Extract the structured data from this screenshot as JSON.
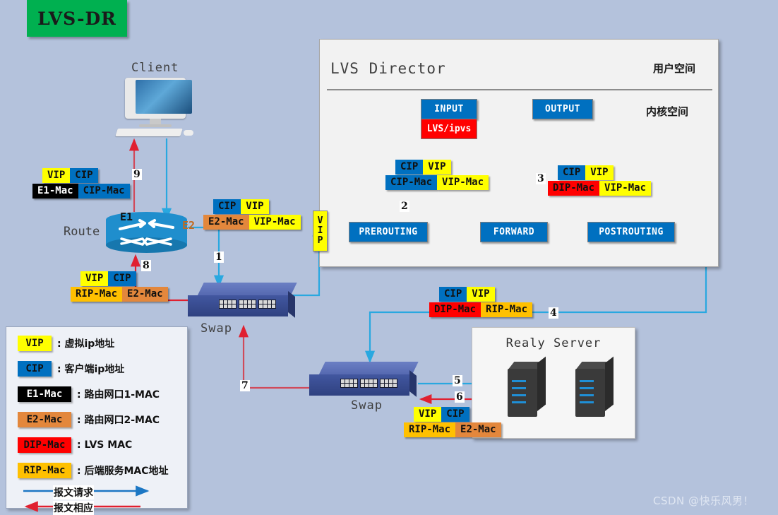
{
  "title": {
    "badge": "LVS-DR"
  },
  "nodes": {
    "client_label": "Client",
    "router_label": "Route",
    "router_if1": "E1",
    "router_if2": "E2",
    "switch1_label": "Swap",
    "switch2_label": "Swap",
    "realy_server_title": "Realy Server"
  },
  "director": {
    "title": "LVS Director",
    "user_space": "用户空间",
    "kernel_space": "内核空间",
    "input": "INPUT",
    "ipvs": "LVS/ipvs",
    "output": "OUTPUT",
    "prerouting": "PREROUTING",
    "forward": "FORWARD",
    "postrouting": "POSTROUTING",
    "vip_vertical": [
      "V",
      "I",
      "P"
    ]
  },
  "packets": {
    "p9": {
      "ip_src": "VIP",
      "ip_dst": "CIP",
      "mac_src": "E1-Mac",
      "mac_dst": "CIP-Mac"
    },
    "p1": {
      "ip_src": "CIP",
      "ip_dst": "VIP",
      "mac_src": "E2-Mac",
      "mac_dst": "VIP-Mac"
    },
    "p2": {
      "ip_src": "CIP",
      "ip_dst": "VIP",
      "mac_src": "CIP-Mac",
      "mac_dst": "VIP-Mac"
    },
    "p3": {
      "ip_src": "CIP",
      "ip_dst": "VIP",
      "mac_src": "DIP-Mac",
      "mac_dst": "VIP-Mac"
    },
    "p4": {
      "ip_src": "CIP",
      "ip_dst": "VIP",
      "mac_src": "DIP-Mac",
      "mac_dst": "RIP-Mac"
    },
    "p6": {
      "ip_src": "VIP",
      "ip_dst": "CIP",
      "mac_src": "RIP-Mac",
      "mac_dst": "E2-Mac"
    },
    "p8": {
      "ip_src": "VIP",
      "ip_dst": "CIP",
      "mac_src": "RIP-Mac",
      "mac_dst": "E2-Mac"
    }
  },
  "steps": [
    "1",
    "2",
    "3",
    "4",
    "5",
    "6",
    "7",
    "8",
    "9"
  ],
  "legend": {
    "items": [
      {
        "chip": "VIP",
        "chip_color": "#ffff00",
        "text_color": "#111111",
        "desc": ": 虚拟ip地址"
      },
      {
        "chip": "CIP",
        "chip_color": "#0070c0",
        "text_color": "#111111",
        "desc": ": 客户端ip地址"
      },
      {
        "chip": "E1-Mac",
        "chip_color": "#000000",
        "text_color": "#ffffff",
        "desc": ": 路由网口1-MAC"
      },
      {
        "chip": "E2-Mac",
        "chip_color": "#e3873c",
        "text_color": "#111111",
        "desc": ": 路由网口2-MAC"
      },
      {
        "chip": "DIP-Mac",
        "chip_color": "#ff0000",
        "text_color": "#111111",
        "desc": ": LVS MAC"
      },
      {
        "chip": "RIP-Mac",
        "chip_color": "#ffc000",
        "text_color": "#111111",
        "desc": ": 后端服务MAC地址"
      }
    ],
    "request_line": "报文请求",
    "response_line": "报文相应"
  },
  "colors": {
    "background": "#b4c2dc",
    "request_arrow": "#29a8e0",
    "response_arrow": "#e02030",
    "accent_green": "#00b050",
    "netfilter_blue": "#0070c0"
  },
  "watermark": "CSDN @快乐风男！"
}
